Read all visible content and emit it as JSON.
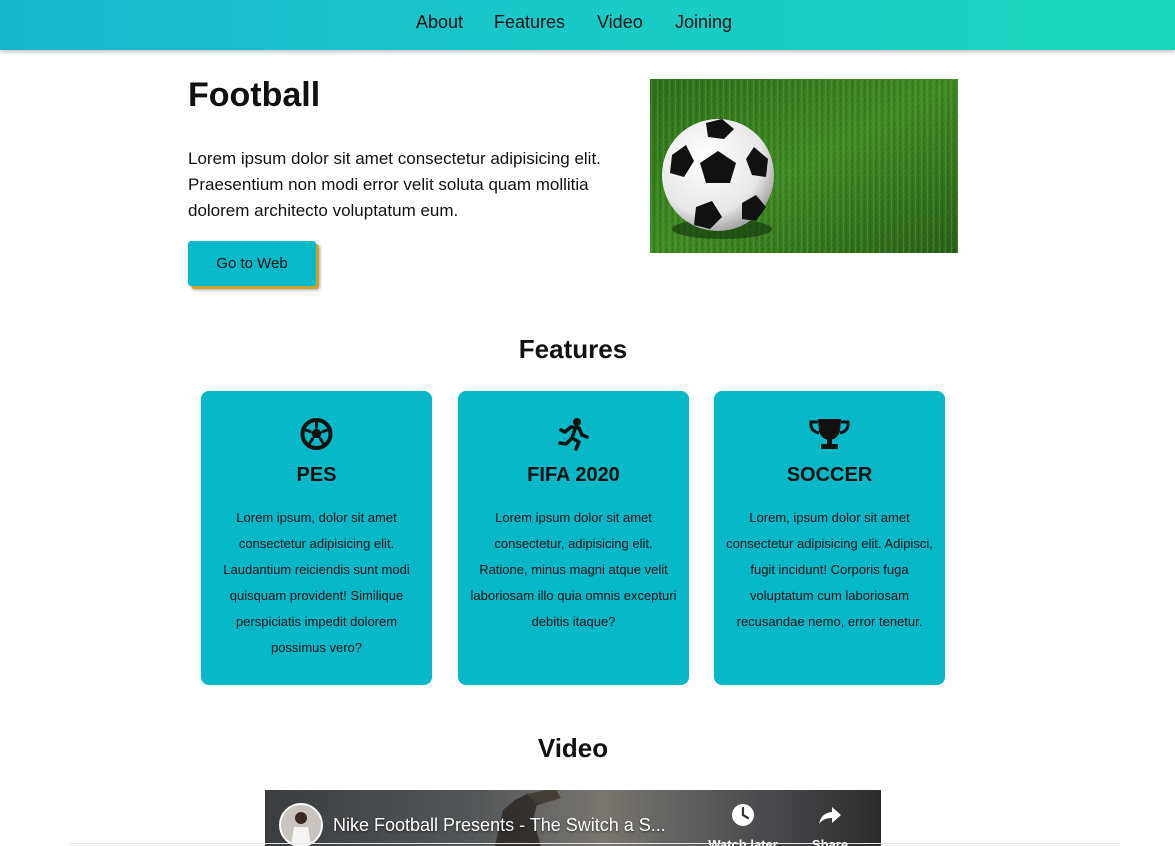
{
  "nav": {
    "items": [
      {
        "label": "About"
      },
      {
        "label": "Features"
      },
      {
        "label": "Video"
      },
      {
        "label": "Joining"
      }
    ]
  },
  "hero": {
    "title": "Football",
    "text": "Lorem ipsum dolor sit amet consectetur adipisicing elit. Praesentium non modi error velit soluta quam mollitia dolorem architecto voluptatum eum.",
    "button_label": "Go to Web"
  },
  "features": {
    "title": "Features",
    "cards": [
      {
        "icon": "soccer-ball-icon",
        "title": "PES",
        "text": "Lorem ipsum, dolor sit amet consectetur adipisicing elit. Laudantium reiciendis sunt modi quisquam provident! Similique perspiciatis impedit dolorem possimus vero?"
      },
      {
        "icon": "running-person-icon",
        "title": "FIFA 2020",
        "text": "Lorem ipsum dolor sit amet consectetur, adipisicing elit. Ratione, minus magni atque velit laboriosam illo quia omnis excepturi debitis itaque?"
      },
      {
        "icon": "trophy-icon",
        "title": "SOCCER",
        "text": "Lorem, ipsum dolor sit amet consectetur adipisicing elit. Adipisci, fugit incidunt! Corporis fuga voluptatum cum laboriosam recusandae nemo, error tenetur."
      }
    ]
  },
  "video": {
    "title": "Video",
    "video_title": "Nike Football Presents - The Switch a S...",
    "watch_later_label": "Watch later",
    "share_label": "Share"
  },
  "colors": {
    "nav_gradient_start": "#17b6cf",
    "nav_gradient_end": "#1ad6bb",
    "card_bg": "#07b8c8",
    "button_bg": "#08b9c9",
    "button_shadow": "#c9a227"
  }
}
